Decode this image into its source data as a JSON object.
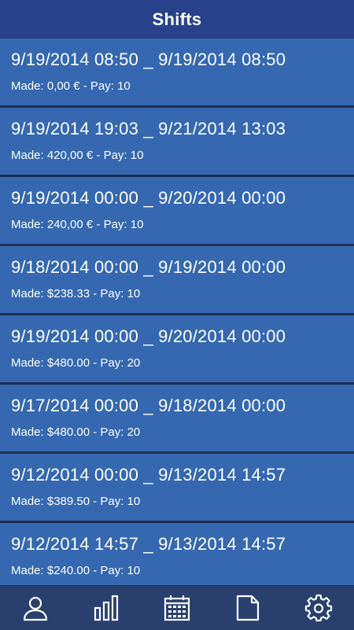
{
  "header": {
    "title": "Shifts"
  },
  "shifts": [
    {
      "dates": "9/19/2014 08:50 _ 9/19/2014 08:50",
      "made": "Made: 0,00 € - Pay: 10"
    },
    {
      "dates": "9/19/2014 19:03 _ 9/21/2014 13:03",
      "made": "Made: 420,00 € - Pay: 10"
    },
    {
      "dates": "9/19/2014 00:00 _ 9/20/2014 00:00",
      "made": "Made: 240,00 € - Pay: 10"
    },
    {
      "dates": "9/18/2014 00:00 _ 9/19/2014 00:00",
      "made": "Made: $238.33 - Pay: 10"
    },
    {
      "dates": "9/19/2014 00:00 _ 9/20/2014 00:00",
      "made": "Made: $480.00 - Pay: 20"
    },
    {
      "dates": "9/17/2014 00:00 _ 9/18/2014 00:00",
      "made": "Made: $480.00 - Pay: 20"
    },
    {
      "dates": "9/12/2014 00:00 _ 9/13/2014 14:57",
      "made": "Made: $389.50 - Pay: 10"
    },
    {
      "dates": "9/12/2014 14:57 _ 9/13/2014 14:57",
      "made": "Made: $240.00 - Pay: 10"
    }
  ],
  "tabs": [
    {
      "icon": "person-icon"
    },
    {
      "icon": "bar-chart-icon"
    },
    {
      "icon": "calendar-icon"
    },
    {
      "icon": "document-icon"
    },
    {
      "icon": "gear-icon"
    }
  ],
  "colors": {
    "header_bg": "#28418a",
    "row_bg": "#3568b0",
    "divider": "#1e2d55",
    "tabbar_bg": "#29406f",
    "text": "#ffffff"
  }
}
